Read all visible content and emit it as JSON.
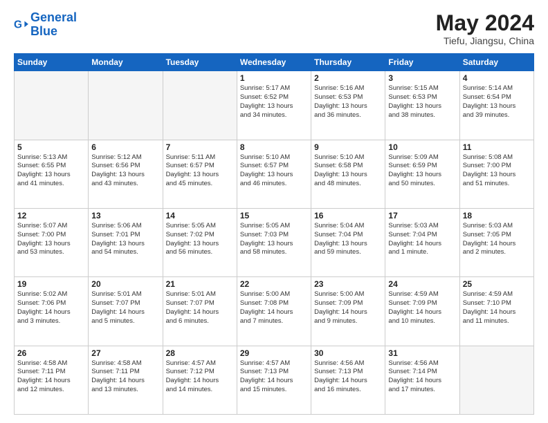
{
  "header": {
    "logo_general": "General",
    "logo_blue": "Blue",
    "title": "May 2024",
    "subtitle": "Tiefu, Jiangsu, China"
  },
  "weekdays": [
    "Sunday",
    "Monday",
    "Tuesday",
    "Wednesday",
    "Thursday",
    "Friday",
    "Saturday"
  ],
  "weeks": [
    [
      {
        "day": "",
        "info": ""
      },
      {
        "day": "",
        "info": ""
      },
      {
        "day": "",
        "info": ""
      },
      {
        "day": "1",
        "info": "Sunrise: 5:17 AM\nSunset: 6:52 PM\nDaylight: 13 hours\nand 34 minutes."
      },
      {
        "day": "2",
        "info": "Sunrise: 5:16 AM\nSunset: 6:53 PM\nDaylight: 13 hours\nand 36 minutes."
      },
      {
        "day": "3",
        "info": "Sunrise: 5:15 AM\nSunset: 6:53 PM\nDaylight: 13 hours\nand 38 minutes."
      },
      {
        "day": "4",
        "info": "Sunrise: 5:14 AM\nSunset: 6:54 PM\nDaylight: 13 hours\nand 39 minutes."
      }
    ],
    [
      {
        "day": "5",
        "info": "Sunrise: 5:13 AM\nSunset: 6:55 PM\nDaylight: 13 hours\nand 41 minutes."
      },
      {
        "day": "6",
        "info": "Sunrise: 5:12 AM\nSunset: 6:56 PM\nDaylight: 13 hours\nand 43 minutes."
      },
      {
        "day": "7",
        "info": "Sunrise: 5:11 AM\nSunset: 6:57 PM\nDaylight: 13 hours\nand 45 minutes."
      },
      {
        "day": "8",
        "info": "Sunrise: 5:10 AM\nSunset: 6:57 PM\nDaylight: 13 hours\nand 46 minutes."
      },
      {
        "day": "9",
        "info": "Sunrise: 5:10 AM\nSunset: 6:58 PM\nDaylight: 13 hours\nand 48 minutes."
      },
      {
        "day": "10",
        "info": "Sunrise: 5:09 AM\nSunset: 6:59 PM\nDaylight: 13 hours\nand 50 minutes."
      },
      {
        "day": "11",
        "info": "Sunrise: 5:08 AM\nSunset: 7:00 PM\nDaylight: 13 hours\nand 51 minutes."
      }
    ],
    [
      {
        "day": "12",
        "info": "Sunrise: 5:07 AM\nSunset: 7:00 PM\nDaylight: 13 hours\nand 53 minutes."
      },
      {
        "day": "13",
        "info": "Sunrise: 5:06 AM\nSunset: 7:01 PM\nDaylight: 13 hours\nand 54 minutes."
      },
      {
        "day": "14",
        "info": "Sunrise: 5:05 AM\nSunset: 7:02 PM\nDaylight: 13 hours\nand 56 minutes."
      },
      {
        "day": "15",
        "info": "Sunrise: 5:05 AM\nSunset: 7:03 PM\nDaylight: 13 hours\nand 58 minutes."
      },
      {
        "day": "16",
        "info": "Sunrise: 5:04 AM\nSunset: 7:04 PM\nDaylight: 13 hours\nand 59 minutes."
      },
      {
        "day": "17",
        "info": "Sunrise: 5:03 AM\nSunset: 7:04 PM\nDaylight: 14 hours\nand 1 minute."
      },
      {
        "day": "18",
        "info": "Sunrise: 5:03 AM\nSunset: 7:05 PM\nDaylight: 14 hours\nand 2 minutes."
      }
    ],
    [
      {
        "day": "19",
        "info": "Sunrise: 5:02 AM\nSunset: 7:06 PM\nDaylight: 14 hours\nand 3 minutes."
      },
      {
        "day": "20",
        "info": "Sunrise: 5:01 AM\nSunset: 7:07 PM\nDaylight: 14 hours\nand 5 minutes."
      },
      {
        "day": "21",
        "info": "Sunrise: 5:01 AM\nSunset: 7:07 PM\nDaylight: 14 hours\nand 6 minutes."
      },
      {
        "day": "22",
        "info": "Sunrise: 5:00 AM\nSunset: 7:08 PM\nDaylight: 14 hours\nand 7 minutes."
      },
      {
        "day": "23",
        "info": "Sunrise: 5:00 AM\nSunset: 7:09 PM\nDaylight: 14 hours\nand 9 minutes."
      },
      {
        "day": "24",
        "info": "Sunrise: 4:59 AM\nSunset: 7:09 PM\nDaylight: 14 hours\nand 10 minutes."
      },
      {
        "day": "25",
        "info": "Sunrise: 4:59 AM\nSunset: 7:10 PM\nDaylight: 14 hours\nand 11 minutes."
      }
    ],
    [
      {
        "day": "26",
        "info": "Sunrise: 4:58 AM\nSunset: 7:11 PM\nDaylight: 14 hours\nand 12 minutes."
      },
      {
        "day": "27",
        "info": "Sunrise: 4:58 AM\nSunset: 7:11 PM\nDaylight: 14 hours\nand 13 minutes."
      },
      {
        "day": "28",
        "info": "Sunrise: 4:57 AM\nSunset: 7:12 PM\nDaylight: 14 hours\nand 14 minutes."
      },
      {
        "day": "29",
        "info": "Sunrise: 4:57 AM\nSunset: 7:13 PM\nDaylight: 14 hours\nand 15 minutes."
      },
      {
        "day": "30",
        "info": "Sunrise: 4:56 AM\nSunset: 7:13 PM\nDaylight: 14 hours\nand 16 minutes."
      },
      {
        "day": "31",
        "info": "Sunrise: 4:56 AM\nSunset: 7:14 PM\nDaylight: 14 hours\nand 17 minutes."
      },
      {
        "day": "",
        "info": ""
      }
    ]
  ]
}
